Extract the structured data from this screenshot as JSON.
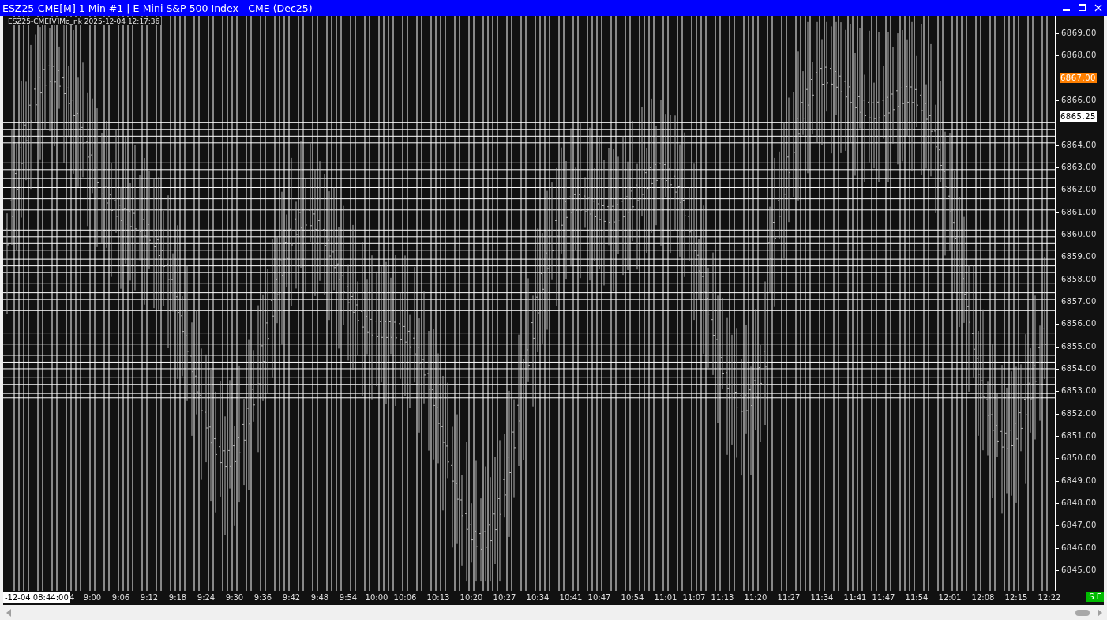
{
  "window": {
    "title": "ESZ25-CME[M]  1 Min  #1 | E-Mini S&P 500 Index - CME (Dec25)"
  },
  "chart": {
    "subtitle": "ESZ25-CME[V]Mo_nk 2025-12-04 12:17:36"
  },
  "y_axis": {
    "labels": [
      "6869.00",
      "6868.00",
      "6866.00",
      "6864.00",
      "6863.00",
      "6862.00",
      "6861.00",
      "6860.00",
      "6859.00",
      "6858.00",
      "6857.00",
      "6856.00",
      "6855.00",
      "6854.00",
      "6853.00",
      "6852.00",
      "6851.00",
      "6850.00",
      "6849.00",
      "6848.00",
      "6847.00",
      "6846.00",
      "6845.00"
    ],
    "markers": [
      {
        "label": "6867.00",
        "kind": "last"
      },
      {
        "label": "6865.25",
        "kind": "cursor"
      }
    ]
  },
  "x_axis": {
    "cursor_label": "-12-04 08:44:00",
    "cursor_tail": "4",
    "labels": [
      "9:00",
      "9:06",
      "9:12",
      "9:18",
      "9:24",
      "9:30",
      "9:36",
      "9:42",
      "9:48",
      "9:54",
      "10:00",
      "10:06",
      "10:13",
      "10:20",
      "10:27",
      "10:34",
      "10:41",
      "10:47",
      "10:54",
      "11:01",
      "11:07",
      "11:13",
      "11:20",
      "11:27",
      "11:34",
      "11:41",
      "11:47",
      "11:54",
      "12:01",
      "12:08",
      "12:15",
      "12:22"
    ]
  },
  "badge": {
    "label": "S E"
  }
}
